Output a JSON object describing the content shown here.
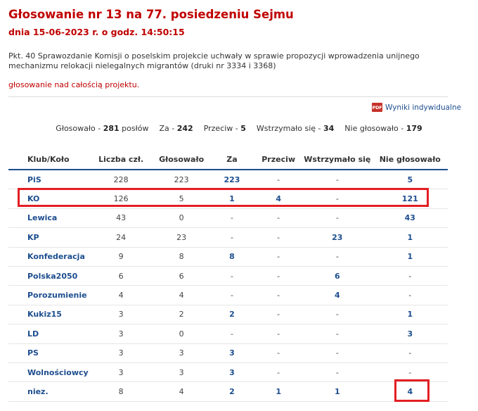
{
  "header": {
    "title": "Głosowanie nr 13 na 77. posiedzeniu Sejmu",
    "subtitle": "dnia 15-06-2023 r. o godz. 14:50:15",
    "description": "Pkt. 40 Sprawozdanie Komisji o poselskim projekcie uchwały w sprawie propozycji wprowadzenia unijnego mechanizmu relokacji nielegalnych migrantów (druki nr 3334 i 3368)",
    "vote_type": "głosowanie nad całością projektu."
  },
  "individual_results": {
    "label": "Wyniki indywidualne",
    "icon_text": "PDF",
    "icon": "pdf-icon"
  },
  "summary": {
    "voted_label": "Głosowało -",
    "voted": "281",
    "voted_suffix": "posłów",
    "for_label": "Za -",
    "for": "242",
    "against_label": "Przeciw -",
    "against": "5",
    "abstain_label": "Wstrzymało się -",
    "abstain": "34",
    "not_voted_label": "Nie głosowało -",
    "not_voted": "179"
  },
  "table": {
    "headers": [
      "Klub/Koło",
      "Liczba czł.",
      "Głosowało",
      "Za",
      "Przeciw",
      "Wstrzymało się",
      "Nie głosowało"
    ],
    "rows": [
      [
        "PiS",
        "228",
        "223",
        "223",
        "-",
        "-",
        "5"
      ],
      [
        "KO",
        "126",
        "5",
        "1",
        "4",
        "-",
        "121"
      ],
      [
        "Lewica",
        "43",
        "0",
        "-",
        "-",
        "-",
        "43"
      ],
      [
        "KP",
        "24",
        "23",
        "-",
        "-",
        "23",
        "1"
      ],
      [
        "Konfederacja",
        "9",
        "8",
        "8",
        "-",
        "-",
        "1"
      ],
      [
        "Polska2050",
        "6",
        "6",
        "-",
        "-",
        "6",
        "-"
      ],
      [
        "Porozumienie",
        "4",
        "4",
        "-",
        "-",
        "4",
        "-"
      ],
      [
        "Kukiz15",
        "3",
        "2",
        "2",
        "-",
        "-",
        "1"
      ],
      [
        "LD",
        "3",
        "0",
        "-",
        "-",
        "-",
        "3"
      ],
      [
        "PS",
        "3",
        "3",
        "3",
        "-",
        "-",
        "-"
      ],
      [
        "Wolnościowcy",
        "3",
        "3",
        "3",
        "-",
        "-",
        "-"
      ],
      [
        "niez.",
        "8",
        "4",
        "2",
        "1",
        "1",
        "4"
      ]
    ]
  },
  "colors": {
    "accent_red": "#c00000",
    "link_blue": "#1d4e8f",
    "highlight": "#e31e24"
  }
}
